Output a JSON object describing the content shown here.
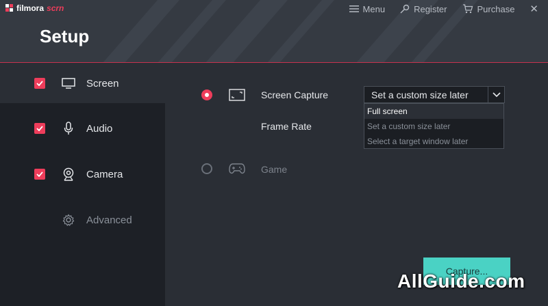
{
  "app": {
    "logo_main": "filmora",
    "logo_accent": "scrn"
  },
  "header": {
    "title": "Setup",
    "menu_label": "Menu",
    "register_label": "Register",
    "purchase_label": "Purchase",
    "close_glyph": "✕"
  },
  "sidebar": {
    "items": [
      {
        "label": "Screen",
        "checked": true,
        "icon": "monitor-icon"
      },
      {
        "label": "Audio",
        "checked": true,
        "icon": "microphone-icon"
      },
      {
        "label": "Camera",
        "checked": true,
        "icon": "webcam-icon"
      },
      {
        "label": "Advanced",
        "checked": false,
        "icon": "gear-icon"
      }
    ]
  },
  "main": {
    "screen_capture": {
      "label": "Screen Capture",
      "selected": true,
      "size_select": {
        "value": "Set a custom size later",
        "options": [
          "Full screen",
          "Set a custom size later",
          "Select a target window later"
        ],
        "highlighted": "Full screen"
      }
    },
    "frame_rate_label": "Frame Rate",
    "game": {
      "label": "Game",
      "selected": false
    }
  },
  "capture_button": "Capture...",
  "watermark": "AllGuide.com",
  "colors": {
    "accent": "#ee3d5b",
    "capture": "#4ad2c4",
    "header_bg": "#353a42",
    "sidebar_bg": "#1d2026"
  }
}
